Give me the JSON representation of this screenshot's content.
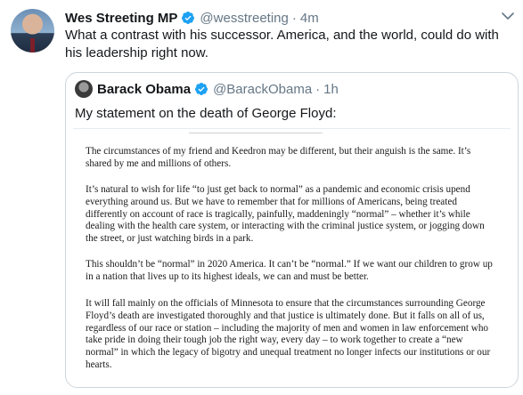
{
  "tweet": {
    "author_name": "Wes Streeting MP",
    "handle": "@wesstreeting",
    "separator": "·",
    "time": "4m",
    "text": "What a contrast with his successor. America, and the world, could do with his leadership right now."
  },
  "quoted_tweet": {
    "author_name": "Barack Obama",
    "handle": "@BarackObama",
    "separator": "·",
    "time": "1h",
    "text": "My statement on the death of George Floyd:",
    "statement_paragraphs": [
      "The circumstances of my friend and Keedron may be different, but their anguish is the same. It’s shared by me and millions of others.",
      "It’s natural to wish for life “to just get back to normal” as a pandemic and economic crisis upend everything around us. But we have to remember that for millions of Americans, being treated differently on account of race is tragically, painfully, maddeningly “normal” – whether it’s while dealing with the health care system, or interacting with the criminal justice system, or jogging down the street, or just watching birds in a park.",
      "This shouldn’t be “normal” in 2020 America. It can’t be “normal.” If we want our children to grow up in a nation that lives up to its highest ideals, we can and must be better.",
      "It will fall mainly on the officials of Minnesota to ensure that the circumstances surrounding George Floyd’s death are investigated thoroughly and that justice is ultimately done. But it falls on all of us, regardless of our race or station – including the majority of men and women in law enforcement who take pride in doing their tough job the right way, every day – to work together to create a “new normal” in which the legacy of bigotry and unequal treatment no longer infects our institutions or our hearts."
    ]
  },
  "icons": {
    "verified": "verified-badge-icon",
    "more": "chevron-down-icon"
  },
  "colors": {
    "verified_blue": "#1da1f2",
    "secondary_text": "#657786",
    "border": "#ccd6dd"
  }
}
